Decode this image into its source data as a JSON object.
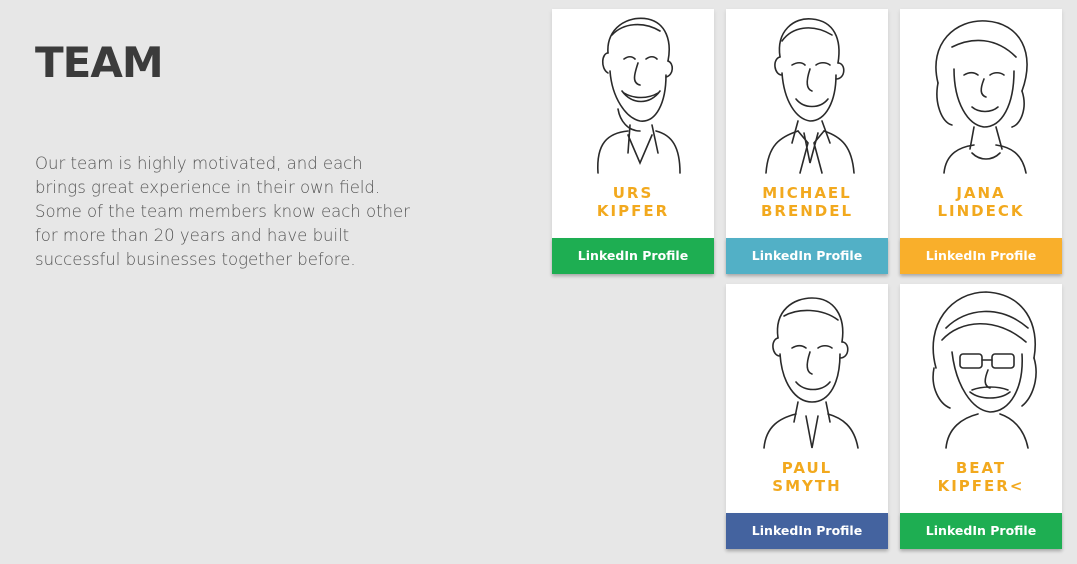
{
  "section": {
    "title": "TEAM",
    "intro": "Our team is highly motivated, and each brings great experience in their own field. Some of the team members know each other for more than 20 years and have built successful businesses together before."
  },
  "members": [
    {
      "first": "URS",
      "last": "KIPFER",
      "link_label": "LinkedIn Profile",
      "button_color": "#1eae52",
      "portrait_icon": "caricature-portrait-icon"
    },
    {
      "first": "MICHAEL",
      "last": "BRENDEL",
      "link_label": "LinkedIn Profile",
      "button_color": "#52b0c6",
      "portrait_icon": "caricature-portrait-icon"
    },
    {
      "first": "JANA",
      "last": "LINDECK",
      "link_label": "LinkedIn Profile",
      "button_color": "#f9af2b",
      "portrait_icon": "caricature-portrait-icon"
    },
    {
      "first": "PAUL",
      "last": "SMYTH",
      "link_label": "LinkedIn Profile",
      "button_color": "#44639f",
      "portrait_icon": "caricature-portrait-icon"
    },
    {
      "first": "BEAT",
      "last": "KIPFER<",
      "link_label": "LinkedIn Profile",
      "button_color": "#1eae52",
      "portrait_icon": "caricature-portrait-icon"
    }
  ],
  "colors": {
    "background": "#e7e7e7",
    "name_color": "#f2a91e",
    "title_color": "#3b3b3b"
  }
}
